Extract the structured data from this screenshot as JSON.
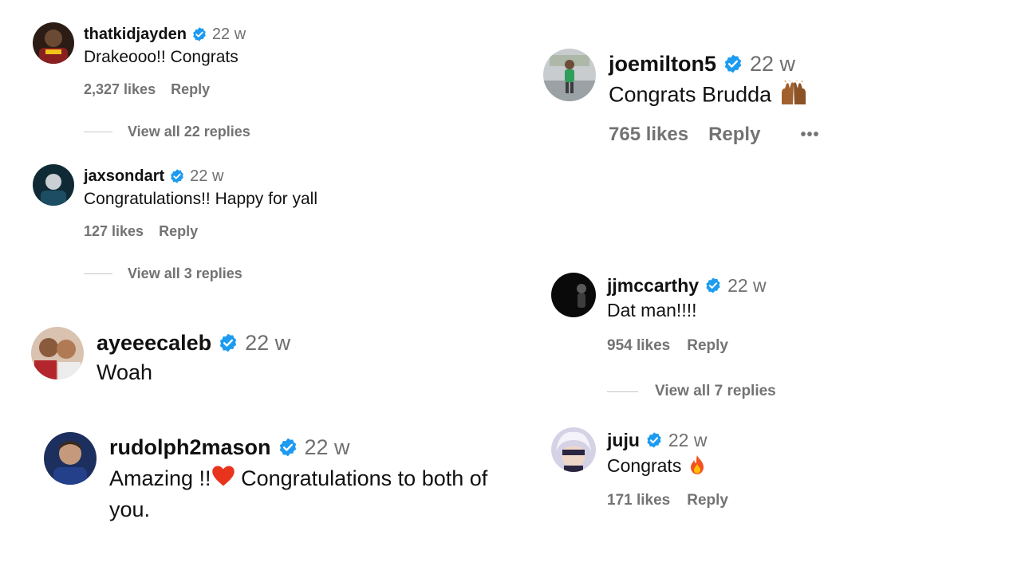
{
  "comments": [
    {
      "username": "thatkidjayden",
      "time": "22 w",
      "text": "Drakeooo!! Congrats",
      "likes": "2,327 likes",
      "reply": "Reply",
      "view_replies": "View all 22 replies"
    },
    {
      "username": "jaxsondart",
      "time": "22 w",
      "text": "Congratulations!! Happy for yall",
      "likes": "127 likes",
      "reply": "Reply",
      "view_replies": "View all 3 replies"
    },
    {
      "username": "ayeeecaleb",
      "time": "22 w",
      "text": "Woah"
    },
    {
      "username": "rudolph2mason",
      "time": "22 w",
      "text_before": "Amazing !!",
      "text_after": " Congratulations to both of you."
    },
    {
      "username": "joemilton5",
      "time": "22 w",
      "text": "Congrats Brudda",
      "likes": "765 likes",
      "reply": "Reply",
      "more": "•••"
    },
    {
      "username": "jjmccarthy",
      "time": "22 w",
      "text": "Dat man!!!!",
      "likes": "954 likes",
      "reply": "Reply",
      "view_replies": "View all 7 replies"
    },
    {
      "username": "juju",
      "time": "22 w",
      "text": "Congrats",
      "likes": "171 likes",
      "reply": "Reply"
    }
  ],
  "icons": {
    "verified": "verified-badge-icon",
    "heart": "red-heart-emoji",
    "fire": "fire-emoji",
    "raised_hands": "raising-hands-emoji"
  },
  "colors": {
    "verified_blue": "#1d9bf0",
    "secondary_text": "#737373"
  }
}
